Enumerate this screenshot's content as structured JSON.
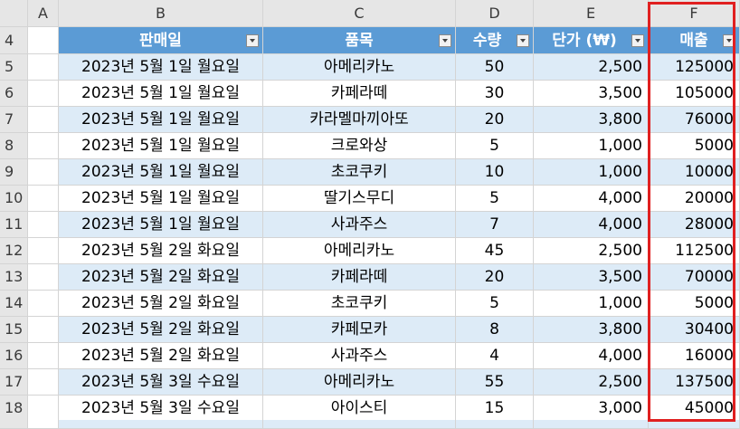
{
  "columns": [
    "A",
    "B",
    "C",
    "D",
    "E",
    "F"
  ],
  "header_row": "4",
  "table_headers": {
    "b": "판매일",
    "c": "품목",
    "d": "수량",
    "e": "단가 (₩)",
    "f": "매출"
  },
  "rows": [
    {
      "num": "5",
      "date": "2023년 5월 1일 월요일",
      "item": "아메리카노",
      "qty": "50",
      "price": "2,500",
      "sales": "125000"
    },
    {
      "num": "6",
      "date": "2023년 5월 1일 월요일",
      "item": "카페라떼",
      "qty": "30",
      "price": "3,500",
      "sales": "105000"
    },
    {
      "num": "7",
      "date": "2023년 5월 1일 월요일",
      "item": "카라멜마끼아또",
      "qty": "20",
      "price": "3,800",
      "sales": "76000"
    },
    {
      "num": "8",
      "date": "2023년 5월 1일 월요일",
      "item": "크로와상",
      "qty": "5",
      "price": "1,000",
      "sales": "5000"
    },
    {
      "num": "9",
      "date": "2023년 5월 1일 월요일",
      "item": "초코쿠키",
      "qty": "10",
      "price": "1,000",
      "sales": "10000"
    },
    {
      "num": "10",
      "date": "2023년 5월 1일 월요일",
      "item": "딸기스무디",
      "qty": "5",
      "price": "4,000",
      "sales": "20000"
    },
    {
      "num": "11",
      "date": "2023년 5월 1일 월요일",
      "item": "사과주스",
      "qty": "7",
      "price": "4,000",
      "sales": "28000"
    },
    {
      "num": "12",
      "date": "2023년 5월 2일 화요일",
      "item": "아메리카노",
      "qty": "45",
      "price": "2,500",
      "sales": "112500"
    },
    {
      "num": "13",
      "date": "2023년 5월 2일 화요일",
      "item": "카페라떼",
      "qty": "20",
      "price": "3,500",
      "sales": "70000"
    },
    {
      "num": "14",
      "date": "2023년 5월 2일 화요일",
      "item": "초코쿠키",
      "qty": "5",
      "price": "1,000",
      "sales": "5000"
    },
    {
      "num": "15",
      "date": "2023년 5월 2일 화요일",
      "item": "카페모카",
      "qty": "8",
      "price": "3,800",
      "sales": "30400"
    },
    {
      "num": "16",
      "date": "2023년 5월 2일 화요일",
      "item": "사과주스",
      "qty": "4",
      "price": "4,000",
      "sales": "16000"
    },
    {
      "num": "17",
      "date": "2023년 5월 3일 수요일",
      "item": "아메리카노",
      "qty": "55",
      "price": "2,500",
      "sales": "137500"
    },
    {
      "num": "18",
      "date": "2023년 5월 3일 수요일",
      "item": "아이스티",
      "qty": "15",
      "price": "3,000",
      "sales": "45000"
    }
  ],
  "colors": {
    "header_fill": "#5b9bd5",
    "band_fill": "#ddebf7",
    "highlight_border": "#e02020"
  }
}
